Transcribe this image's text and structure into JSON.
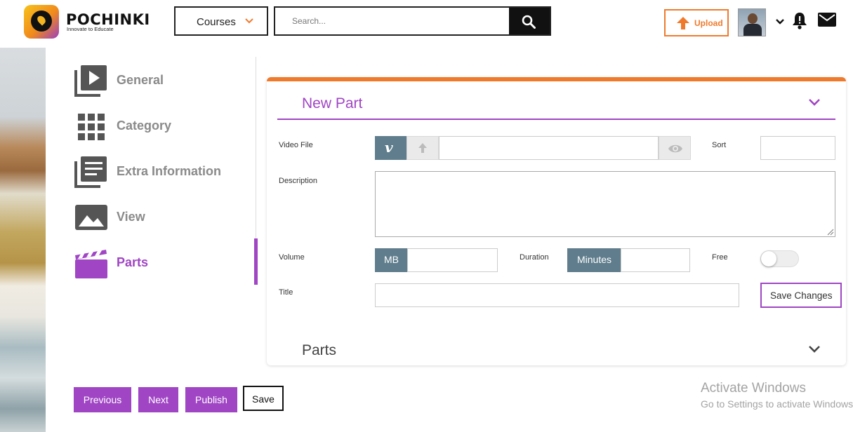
{
  "header": {
    "brand": "POCHINKI",
    "tagline": "Innovate to Educate",
    "courses_label": "Courses",
    "search_placeholder": "Search...",
    "upload_label": "Upload"
  },
  "sidebar": {
    "items": [
      {
        "label": "General",
        "icon": "video-library-icon"
      },
      {
        "label": "Category",
        "icon": "grid-icon"
      },
      {
        "label": "Extra Information",
        "icon": "library-books-icon"
      },
      {
        "label": "View",
        "icon": "image-icon"
      },
      {
        "label": "Parts",
        "icon": "clapperboard-icon",
        "active": true
      }
    ]
  },
  "form": {
    "section_title": "New Part",
    "video_file_label": "Video File",
    "sort_label": "Sort",
    "description_label": "Description",
    "volume_label": "Volume",
    "volume_unit": "MB",
    "duration_label": "Duration",
    "duration_unit": "Minutes",
    "free_label": "Free",
    "free_enabled": false,
    "title_label": "Title",
    "save_changes_label": "Save Changes",
    "parts_title": "Parts"
  },
  "footer": {
    "previous_label": "Previous",
    "next_label": "Next",
    "publish_label": "Publish",
    "save_label": "Save"
  },
  "watermark": {
    "line1": "Activate Windows",
    "line2": "Go to Settings to activate Windows."
  },
  "colors": {
    "accent_purple": "#a045c4",
    "accent_orange": "#f07a2c",
    "addon_slate": "#5f7d8c"
  }
}
